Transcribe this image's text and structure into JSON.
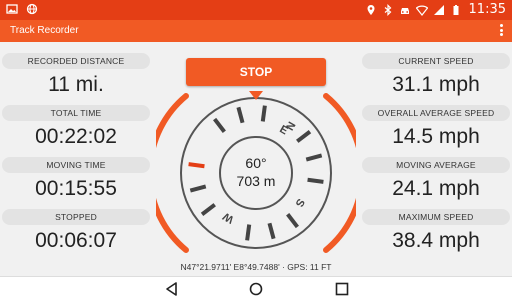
{
  "status_bar": {
    "time": "11:35",
    "icons": [
      "image-icon",
      "globe-icon",
      "location-icon",
      "bluetooth-icon",
      "car-icon",
      "wifi-icon",
      "signal-icon",
      "battery-icon"
    ]
  },
  "app_bar": {
    "title": "Track Recorder",
    "menu_icon": "more-vert-icon"
  },
  "left_stats": [
    {
      "label": "RECORDED DISTANCE",
      "value": "11 mi."
    },
    {
      "label": "TOTAL TIME",
      "value": "00:22:02"
    },
    {
      "label": "MOVING TIME",
      "value": "00:15:55"
    },
    {
      "label": "STOPPED",
      "value": "00:06:07"
    }
  ],
  "right_stats": [
    {
      "label": "CURRENT SPEED",
      "value": "31.1 mph"
    },
    {
      "label": "OVERALL AVERAGE SPEED",
      "value": "14.5 mph"
    },
    {
      "label": "MOVING AVERAGE",
      "value": "24.1 mph"
    },
    {
      "label": "MAXIMUM SPEED",
      "value": "38.4 mph"
    }
  ],
  "stop_button": {
    "label": "STOP"
  },
  "compass": {
    "heading": "60°",
    "altitude": "703 m",
    "letters": [
      "N",
      "E",
      "S",
      "W"
    ]
  },
  "gps_readout": "N47°21.9711' E8°49.7488' · GPS: 11 FT",
  "colors": {
    "status_bar": "#e43e15",
    "app_bar": "#f15a24",
    "accent": "#f15a24"
  },
  "nav_bar": {
    "icons": [
      "back-icon",
      "home-icon",
      "recents-icon"
    ]
  }
}
